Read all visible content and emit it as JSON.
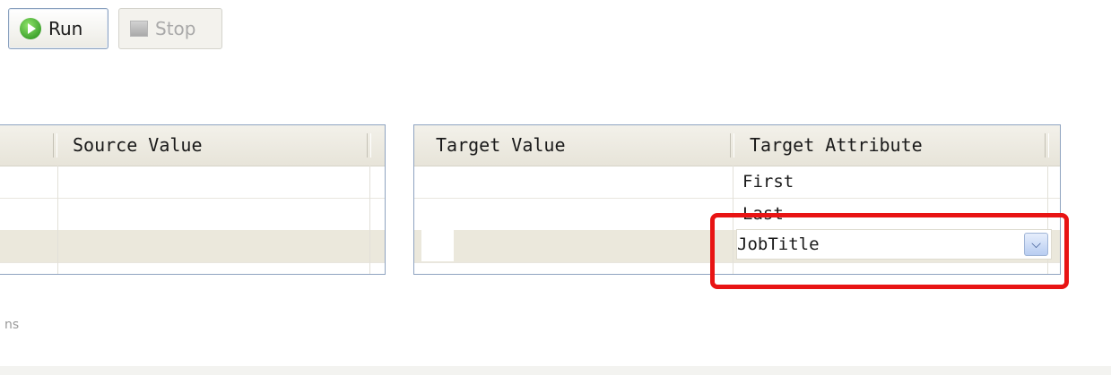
{
  "toolbar": {
    "run_label": "Run",
    "stop_label": "Stop"
  },
  "source_grid": {
    "columns": [
      "Source Value"
    ]
  },
  "target_grid": {
    "columns": [
      "Target Value",
      "Target Attribute"
    ],
    "rows": [
      {
        "target_value": "",
        "target_attribute": "First"
      },
      {
        "target_value": "",
        "target_attribute": "Last"
      }
    ],
    "editing_row": {
      "target_value": "",
      "target_attribute": "JobTitle"
    }
  },
  "fragment_text": "ns",
  "colors": {
    "highlight": "#e81414",
    "grid_border": "#8ea3c0",
    "header_bg": "#ece9df",
    "selected_row": "#ebe8dc"
  },
  "icons": [
    "run-icon",
    "stop-icon",
    "chevron-down-icon"
  ]
}
